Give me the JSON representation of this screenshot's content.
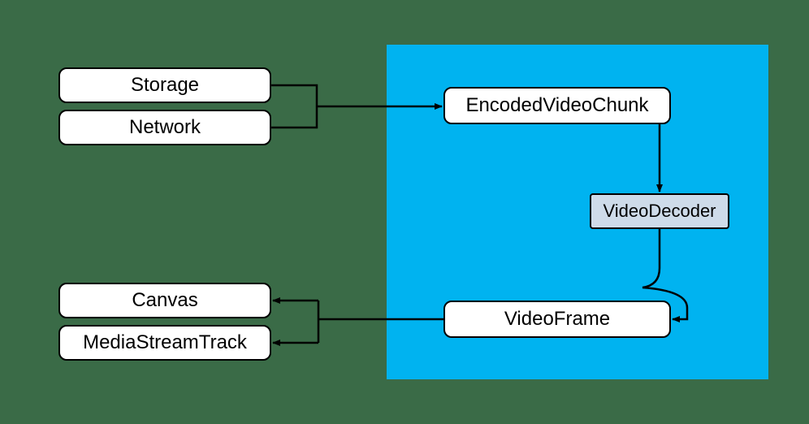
{
  "diagram": {
    "nodes": {
      "storage": {
        "label": "Storage"
      },
      "network": {
        "label": "Network"
      },
      "canvas": {
        "label": "Canvas"
      },
      "mediaStreamTrack": {
        "label": "MediaStreamTrack"
      },
      "encodedVideoChunk": {
        "label": "EncodedVideoChunk"
      },
      "videoDecoder": {
        "label": "VideoDecoder"
      },
      "videoFrame": {
        "label": "VideoFrame"
      }
    },
    "edges": [
      {
        "from": "storage",
        "to": "encodedVideoChunk"
      },
      {
        "from": "network",
        "to": "encodedVideoChunk"
      },
      {
        "from": "encodedVideoChunk",
        "to": "videoDecoder"
      },
      {
        "from": "videoDecoder",
        "to": "videoFrame"
      },
      {
        "from": "videoFrame",
        "to": "canvas"
      },
      {
        "from": "videoFrame",
        "to": "mediaStreamTrack"
      }
    ],
    "highlight_region": "webcodecs-api"
  }
}
